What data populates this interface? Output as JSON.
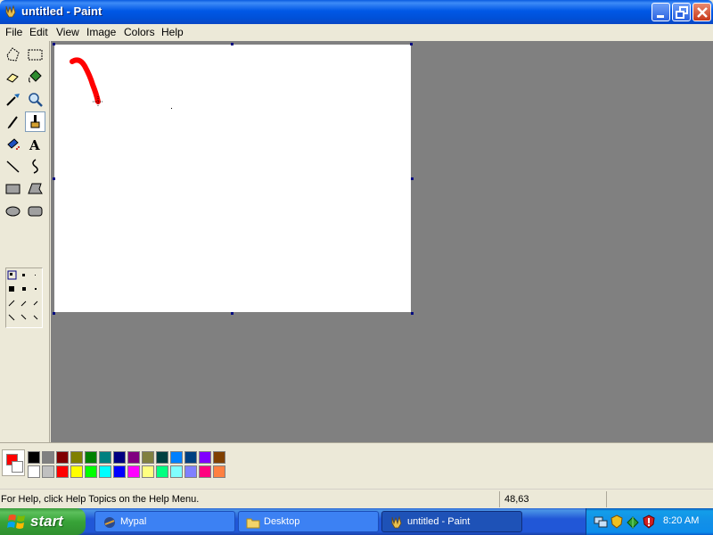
{
  "window": {
    "title": "untitled - Paint"
  },
  "menu": [
    "File",
    "Edit",
    "View",
    "Image",
    "Colors",
    "Help"
  ],
  "tools": [
    "free-form-select",
    "select",
    "eraser",
    "fill-with-color",
    "pick-color",
    "magnifier",
    "pencil",
    "brush",
    "airbrush",
    "text",
    "line",
    "curve",
    "rectangle",
    "polygon",
    "ellipse",
    "rounded-rectangle"
  ],
  "active_tool": "brush",
  "colors": {
    "foreground": "#FF0000",
    "background": "#FFFFFF",
    "palette_row1": [
      "#000000",
      "#808080",
      "#800000",
      "#808000",
      "#008000",
      "#008080",
      "#000080",
      "#800080",
      "#808040",
      "#004040",
      "#0080FF",
      "#004080",
      "#8000FF",
      "#804000"
    ],
    "palette_row2": [
      "#FFFFFF",
      "#C0C0C0",
      "#FF0000",
      "#FFFF00",
      "#00FF00",
      "#00FFFF",
      "#0000FF",
      "#FF00FF",
      "#FFFF80",
      "#00FF80",
      "#80FFFF",
      "#8080FF",
      "#FF0080",
      "#FF8040"
    ]
  },
  "status": {
    "help_text": "For Help, click Help Topics on the Help Menu.",
    "coords": "48,63"
  },
  "taskbar": {
    "start_label": "start",
    "tasks": [
      {
        "label": "Mypal",
        "icon": "mypal-icon"
      },
      {
        "label": "Desktop",
        "icon": "folder-icon"
      },
      {
        "label": "untitled - Paint",
        "icon": "paint-icon"
      }
    ],
    "clock": "8:20 AM"
  }
}
